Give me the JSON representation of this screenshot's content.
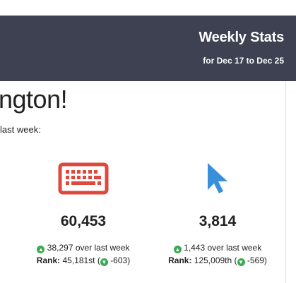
{
  "header": {
    "title": "Weekly Stats",
    "subtitle": "for Dec 17 to Dec 25"
  },
  "greeting": "ngton!",
  "intro": "last week:",
  "colors": {
    "header_bg": "#3d4151",
    "keyboard_icon": "#e0473d",
    "cursor_icon": "#3a8fdb",
    "up_badge": "#3aaa52",
    "down_badge": "#3aaa52"
  },
  "stats": [
    {
      "icon": "keyboard-icon",
      "value": "60,453",
      "change": "38,297 over last week",
      "rank_label": "Rank:",
      "rank_value": "45,181st (",
      "rank_change": "-603)"
    },
    {
      "icon": "cursor-icon",
      "value": "3,814",
      "change": "1,443 over last week",
      "rank_label": "Rank:",
      "rank_value": "125,009th (",
      "rank_change": "-569)"
    }
  ]
}
